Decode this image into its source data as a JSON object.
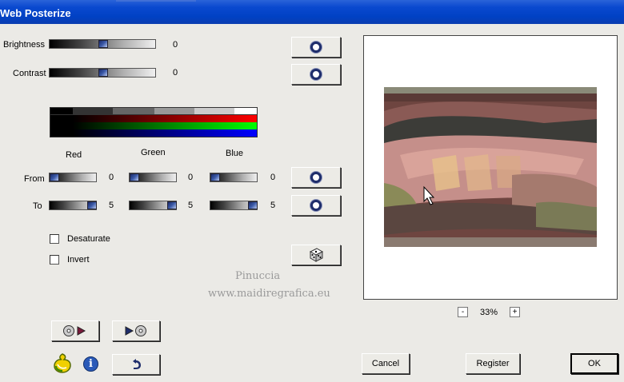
{
  "window": {
    "title": "Web Posterize"
  },
  "adjust": {
    "brightness_label": "Brightness",
    "brightness_value": "0",
    "brightness_level": 0.5,
    "contrast_label": "Contrast",
    "contrast_value": "0",
    "contrast_level": 0.5
  },
  "channels": {
    "red_label": "Red",
    "green_label": "Green",
    "blue_label": "Blue",
    "from_label": "From",
    "to_label": "To",
    "from_values": [
      "0",
      "0",
      "0"
    ],
    "to_values": [
      "5",
      "5",
      "5"
    ]
  },
  "options": {
    "desaturate_label": "Desaturate",
    "invert_label": "Invert"
  },
  "watermark": {
    "line1": "Pinuccia",
    "line2": "www.maidiregrafica.eu"
  },
  "zoom": {
    "minus": "-",
    "value": "33%",
    "plus": "+"
  },
  "buttons": {
    "cancel": "Cancel",
    "register": "Register",
    "ok": "OK"
  },
  "colors": {
    "titlebar": "#0041c4",
    "background": "#ebeae6",
    "ring": "#1e2d6b"
  }
}
